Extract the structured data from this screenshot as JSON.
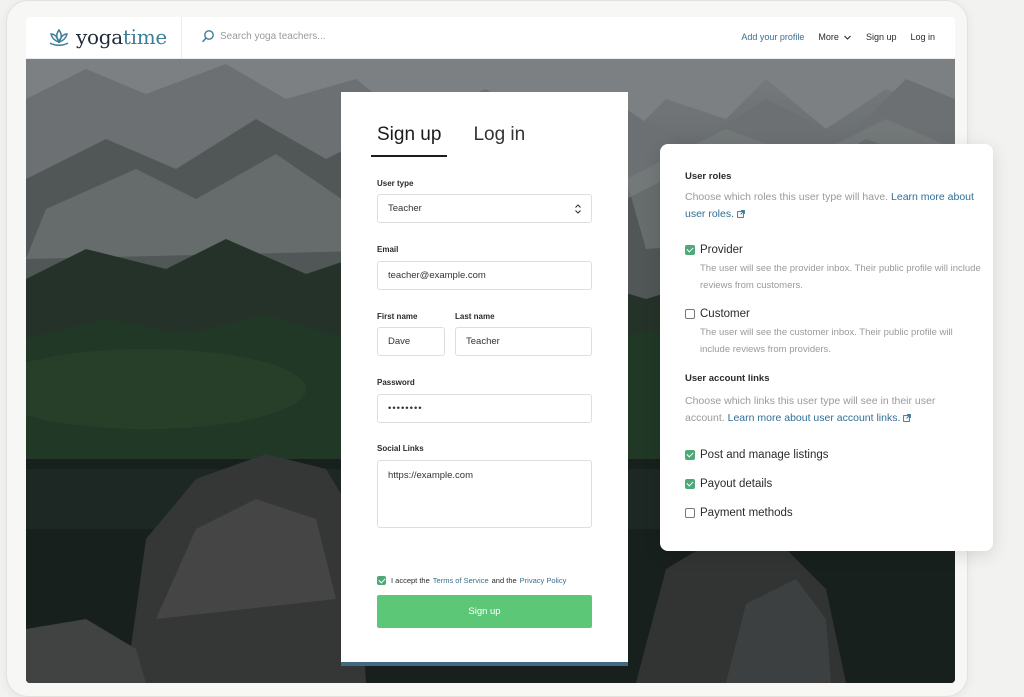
{
  "nav": {
    "logo_yoga": "yoga",
    "logo_time": "time",
    "search_placeholder": "Search yoga teachers...",
    "add_profile": "Add your profile",
    "more": "More",
    "sign_up": "Sign up",
    "log_in": "Log in"
  },
  "signup_card": {
    "tab_signup": "Sign up",
    "tab_login": "Log in",
    "user_type_label": "User type",
    "user_type_value": "Teacher",
    "email_label": "Email",
    "email_value": "teacher@example.com",
    "first_name_label": "First name",
    "first_name_value": "Dave",
    "last_name_label": "Last name",
    "last_name_value": "Teacher",
    "password_label": "Password",
    "password_value": "••••••••",
    "social_label": "Social Links",
    "social_value": "https://example.com",
    "terms_prefix": "I accept the",
    "terms_link": "Terms of Service",
    "terms_and": "and the",
    "privacy_link": "Privacy Policy",
    "terms_checked": true,
    "submit_label": "Sign up",
    "submit_color": "#5cc877"
  },
  "roles_panel": {
    "roles_heading": "User roles",
    "roles_desc": "Choose which roles this user type will have.",
    "roles_link": "Learn more about user roles.",
    "provider_label": "Provider",
    "provider_checked": true,
    "provider_desc": "The user will see the provider inbox. Their public profile will include reviews from customers.",
    "customer_label": "Customer",
    "customer_checked": false,
    "customer_desc": "The user will see the customer inbox. Their public profile will include reviews from providers.",
    "links_heading": "User account links",
    "links_desc": "Choose which links this user type will see in their user account.",
    "links_link": "Learn more about user account links.",
    "links": [
      {
        "label": "Post and manage listings",
        "checked": true
      },
      {
        "label": "Payout details",
        "checked": true
      },
      {
        "label": "Payment methods",
        "checked": false
      }
    ],
    "accent_color": "#4ea877"
  }
}
